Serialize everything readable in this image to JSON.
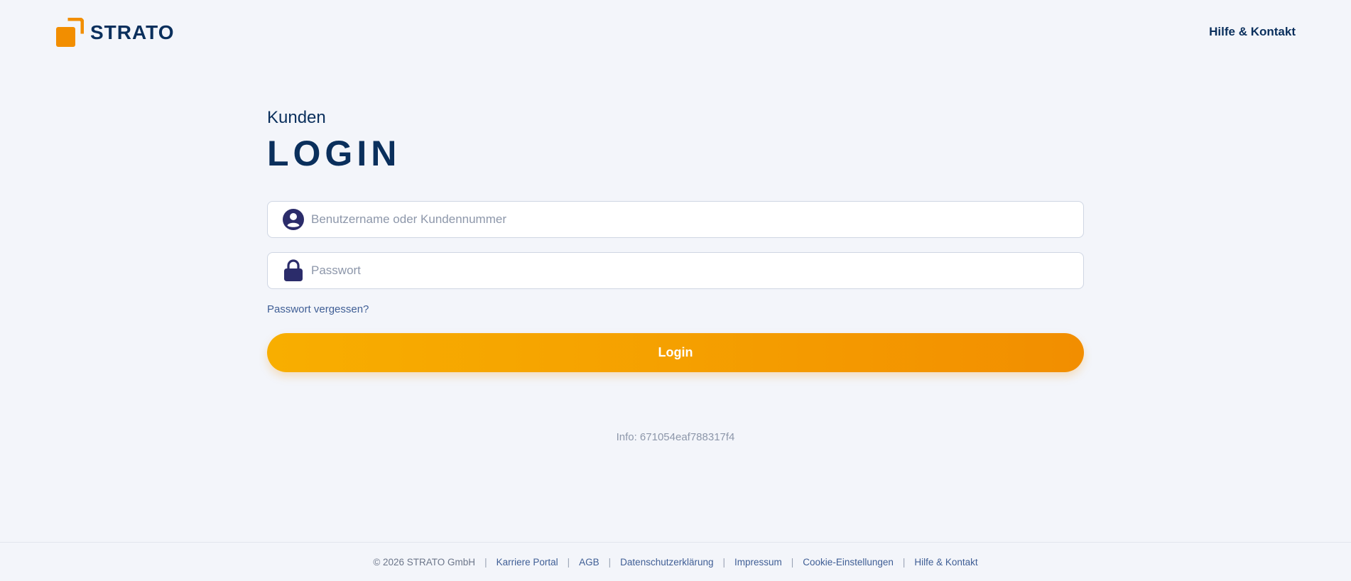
{
  "header": {
    "logo_text": "STRATO",
    "help_link": "Hilfe & Kontakt"
  },
  "login": {
    "subtitle": "Kunden",
    "title": "LOGIN",
    "username": {
      "placeholder": "Benutzername oder Kundennummer",
      "value": "",
      "icon": "user-icon"
    },
    "password": {
      "placeholder": "Passwort",
      "value": "",
      "icon": "lock-icon"
    },
    "forgot_link": "Passwort vergessen?",
    "submit_label": "Login",
    "info": "Info: 671054eaf788317f4"
  },
  "footer": {
    "copyright": "© 2026 STRATO GmbH",
    "separator": "|",
    "links": [
      "Karriere Portal",
      "AGB",
      "Datenschutzerklärung",
      "Impressum",
      "Cookie-Einstellungen",
      "Hilfe & Kontakt"
    ]
  },
  "colors": {
    "brand_orange": "#f28e00",
    "brand_navy": "#0a2f5c",
    "icon_purple": "#2b2c6a",
    "background": "#f3f5fa"
  }
}
